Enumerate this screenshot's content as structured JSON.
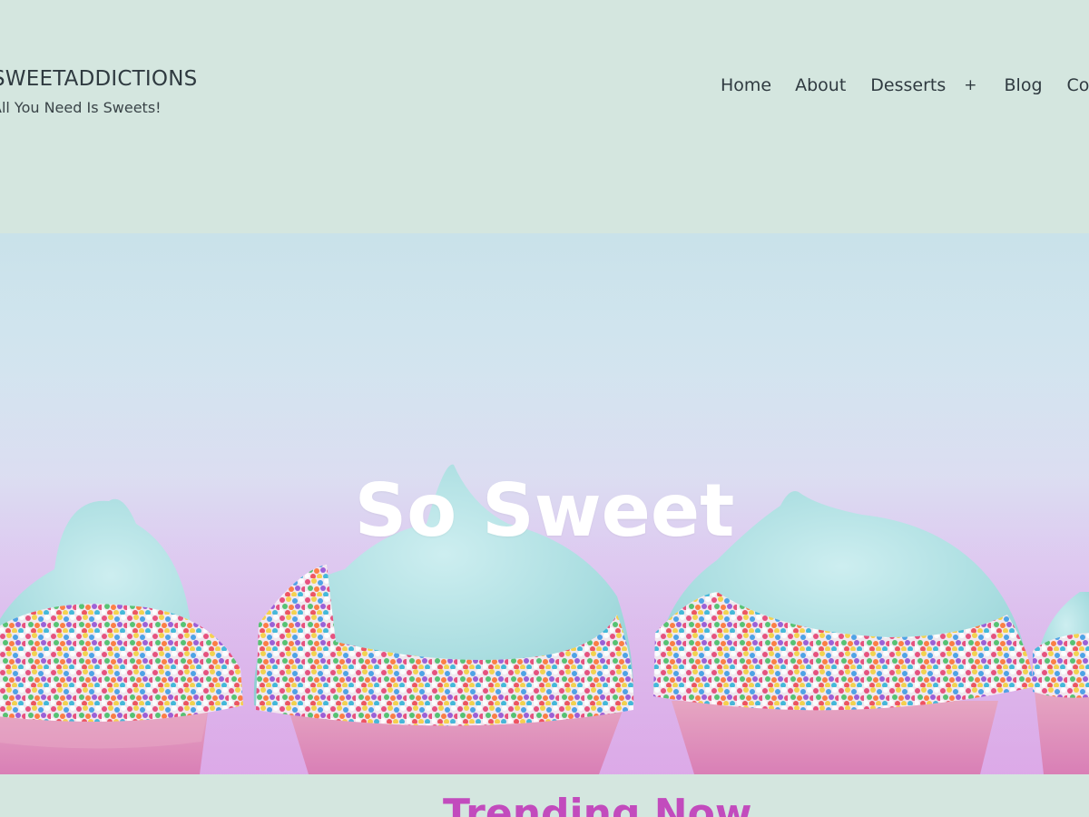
{
  "site": {
    "title": "SWEETADDICTIONS",
    "tagline": "All You Need Is Sweets!"
  },
  "nav": {
    "items": [
      {
        "label": "Home"
      },
      {
        "label": "About"
      },
      {
        "label": "Desserts"
      },
      {
        "label": "Blog"
      },
      {
        "label": "Contact"
      }
    ],
    "submenu_toggle": "+"
  },
  "hero": {
    "title": "So Sweet",
    "image": "cupcakes-with-sprinkles"
  },
  "section": {
    "heading": "Trending Now"
  },
  "colors": {
    "background": "#d4e6df",
    "text": "#2f3a40",
    "accent": "#c24bbd",
    "hero_title": "#ffffff"
  }
}
